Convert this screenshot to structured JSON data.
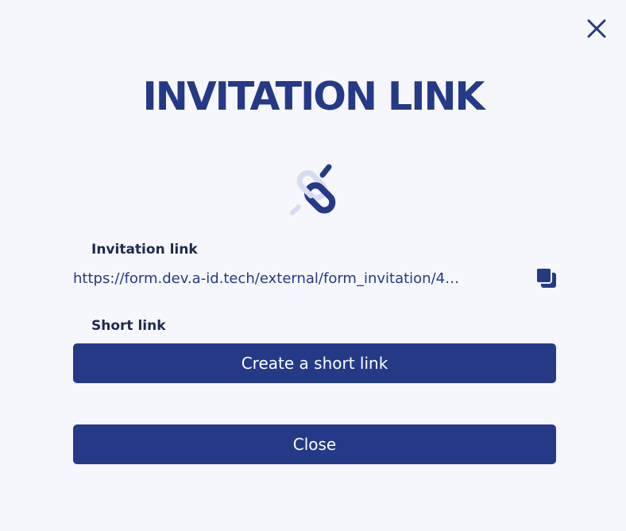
{
  "dialog": {
    "title": "INVITATION LINK",
    "close_icon": "close-icon",
    "link_icon": "chain-link-icon"
  },
  "invitation": {
    "label": "Invitation link",
    "url_display": "https://form.dev.a-id.tech/external/form_invitation/4…",
    "copy_icon": "copy-icon"
  },
  "short_link": {
    "label": "Short link",
    "create_button_label": "Create a short link"
  },
  "footer": {
    "close_button_label": "Close"
  },
  "colors": {
    "primary": "#253a86",
    "background": "#f6f7fc",
    "label_text": "#1f2a4c",
    "link_accent": "#d7dcf0"
  }
}
